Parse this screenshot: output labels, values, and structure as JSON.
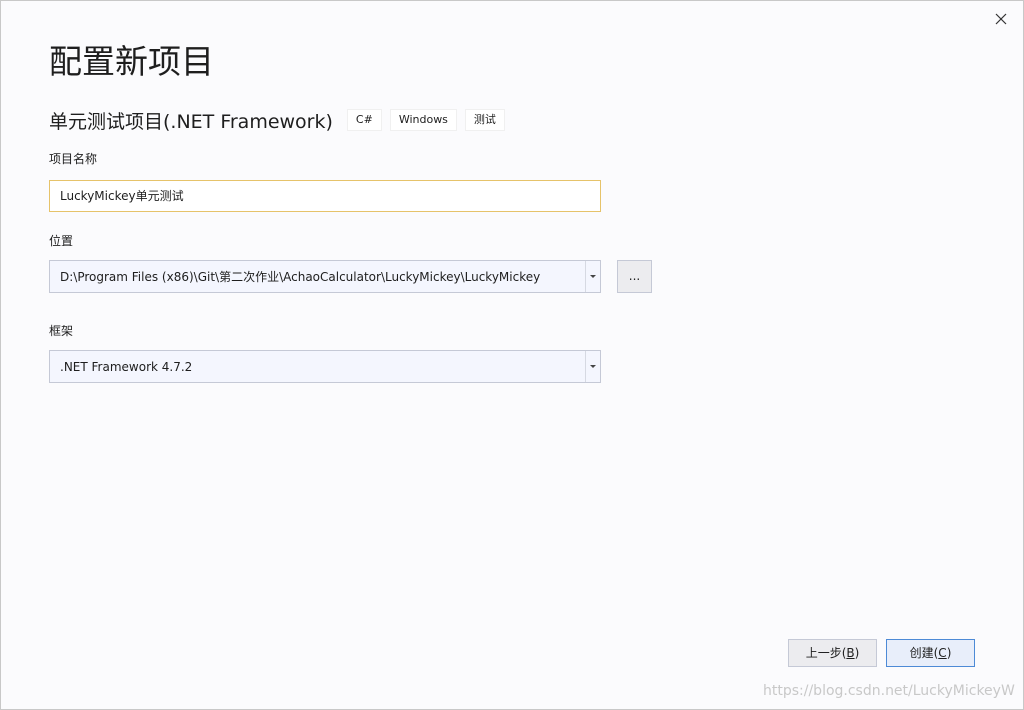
{
  "window": {
    "title": "配置新项目",
    "close_icon": "close-icon"
  },
  "template": {
    "name": "单元测试项目(.NET Framework)",
    "tags": [
      "C#",
      "Windows",
      "测试"
    ]
  },
  "project_name": {
    "label": "项目名称",
    "value": "LuckyMickey单元测试"
  },
  "location": {
    "label": "位置",
    "value": "D:\\Program Files (x86)\\Git\\第二次作业\\AchaoCalculator\\LuckyMickey\\LuckyMickey",
    "browse_label": "..."
  },
  "framework": {
    "label": "框架",
    "value": ".NET Framework 4.7.2"
  },
  "buttons": {
    "back_text": "上一步(",
    "back_key": "B",
    "back_suffix": ")",
    "create_text": "创建(",
    "create_key": "C",
    "create_suffix": ")"
  },
  "watermark": "https://blog.csdn.net/LuckyMickeyW",
  "colors": {
    "accent": "#4d8ad6",
    "focus_border": "#e6c36a",
    "background": "#fbfbfd"
  }
}
